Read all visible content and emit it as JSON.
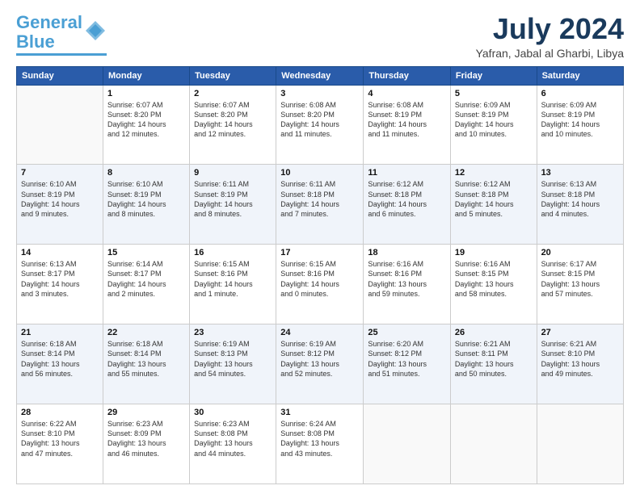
{
  "logo": {
    "line1": "General",
    "line2": "Blue"
  },
  "title": "July 2024",
  "subtitle": "Yafran, Jabal al Gharbi, Libya",
  "days_of_week": [
    "Sunday",
    "Monday",
    "Tuesday",
    "Wednesday",
    "Thursday",
    "Friday",
    "Saturday"
  ],
  "weeks": [
    [
      {
        "day": "",
        "info": ""
      },
      {
        "day": "1",
        "info": "Sunrise: 6:07 AM\nSunset: 8:20 PM\nDaylight: 14 hours\nand 12 minutes."
      },
      {
        "day": "2",
        "info": "Sunrise: 6:07 AM\nSunset: 8:20 PM\nDaylight: 14 hours\nand 12 minutes."
      },
      {
        "day": "3",
        "info": "Sunrise: 6:08 AM\nSunset: 8:20 PM\nDaylight: 14 hours\nand 11 minutes."
      },
      {
        "day": "4",
        "info": "Sunrise: 6:08 AM\nSunset: 8:19 PM\nDaylight: 14 hours\nand 11 minutes."
      },
      {
        "day": "5",
        "info": "Sunrise: 6:09 AM\nSunset: 8:19 PM\nDaylight: 14 hours\nand 10 minutes."
      },
      {
        "day": "6",
        "info": "Sunrise: 6:09 AM\nSunset: 8:19 PM\nDaylight: 14 hours\nand 10 minutes."
      }
    ],
    [
      {
        "day": "7",
        "info": "Sunrise: 6:10 AM\nSunset: 8:19 PM\nDaylight: 14 hours\nand 9 minutes."
      },
      {
        "day": "8",
        "info": "Sunrise: 6:10 AM\nSunset: 8:19 PM\nDaylight: 14 hours\nand 8 minutes."
      },
      {
        "day": "9",
        "info": "Sunrise: 6:11 AM\nSunset: 8:19 PM\nDaylight: 14 hours\nand 8 minutes."
      },
      {
        "day": "10",
        "info": "Sunrise: 6:11 AM\nSunset: 8:18 PM\nDaylight: 14 hours\nand 7 minutes."
      },
      {
        "day": "11",
        "info": "Sunrise: 6:12 AM\nSunset: 8:18 PM\nDaylight: 14 hours\nand 6 minutes."
      },
      {
        "day": "12",
        "info": "Sunrise: 6:12 AM\nSunset: 8:18 PM\nDaylight: 14 hours\nand 5 minutes."
      },
      {
        "day": "13",
        "info": "Sunrise: 6:13 AM\nSunset: 8:18 PM\nDaylight: 14 hours\nand 4 minutes."
      }
    ],
    [
      {
        "day": "14",
        "info": "Sunrise: 6:13 AM\nSunset: 8:17 PM\nDaylight: 14 hours\nand 3 minutes."
      },
      {
        "day": "15",
        "info": "Sunrise: 6:14 AM\nSunset: 8:17 PM\nDaylight: 14 hours\nand 2 minutes."
      },
      {
        "day": "16",
        "info": "Sunrise: 6:15 AM\nSunset: 8:16 PM\nDaylight: 14 hours\nand 1 minute."
      },
      {
        "day": "17",
        "info": "Sunrise: 6:15 AM\nSunset: 8:16 PM\nDaylight: 14 hours\nand 0 minutes."
      },
      {
        "day": "18",
        "info": "Sunrise: 6:16 AM\nSunset: 8:16 PM\nDaylight: 13 hours\nand 59 minutes."
      },
      {
        "day": "19",
        "info": "Sunrise: 6:16 AM\nSunset: 8:15 PM\nDaylight: 13 hours\nand 58 minutes."
      },
      {
        "day": "20",
        "info": "Sunrise: 6:17 AM\nSunset: 8:15 PM\nDaylight: 13 hours\nand 57 minutes."
      }
    ],
    [
      {
        "day": "21",
        "info": "Sunrise: 6:18 AM\nSunset: 8:14 PM\nDaylight: 13 hours\nand 56 minutes."
      },
      {
        "day": "22",
        "info": "Sunrise: 6:18 AM\nSunset: 8:14 PM\nDaylight: 13 hours\nand 55 minutes."
      },
      {
        "day": "23",
        "info": "Sunrise: 6:19 AM\nSunset: 8:13 PM\nDaylight: 13 hours\nand 54 minutes."
      },
      {
        "day": "24",
        "info": "Sunrise: 6:19 AM\nSunset: 8:12 PM\nDaylight: 13 hours\nand 52 minutes."
      },
      {
        "day": "25",
        "info": "Sunrise: 6:20 AM\nSunset: 8:12 PM\nDaylight: 13 hours\nand 51 minutes."
      },
      {
        "day": "26",
        "info": "Sunrise: 6:21 AM\nSunset: 8:11 PM\nDaylight: 13 hours\nand 50 minutes."
      },
      {
        "day": "27",
        "info": "Sunrise: 6:21 AM\nSunset: 8:10 PM\nDaylight: 13 hours\nand 49 minutes."
      }
    ],
    [
      {
        "day": "28",
        "info": "Sunrise: 6:22 AM\nSunset: 8:10 PM\nDaylight: 13 hours\nand 47 minutes."
      },
      {
        "day": "29",
        "info": "Sunrise: 6:23 AM\nSunset: 8:09 PM\nDaylight: 13 hours\nand 46 minutes."
      },
      {
        "day": "30",
        "info": "Sunrise: 6:23 AM\nSunset: 8:08 PM\nDaylight: 13 hours\nand 44 minutes."
      },
      {
        "day": "31",
        "info": "Sunrise: 6:24 AM\nSunset: 8:08 PM\nDaylight: 13 hours\nand 43 minutes."
      },
      {
        "day": "",
        "info": ""
      },
      {
        "day": "",
        "info": ""
      },
      {
        "day": "",
        "info": ""
      }
    ]
  ]
}
